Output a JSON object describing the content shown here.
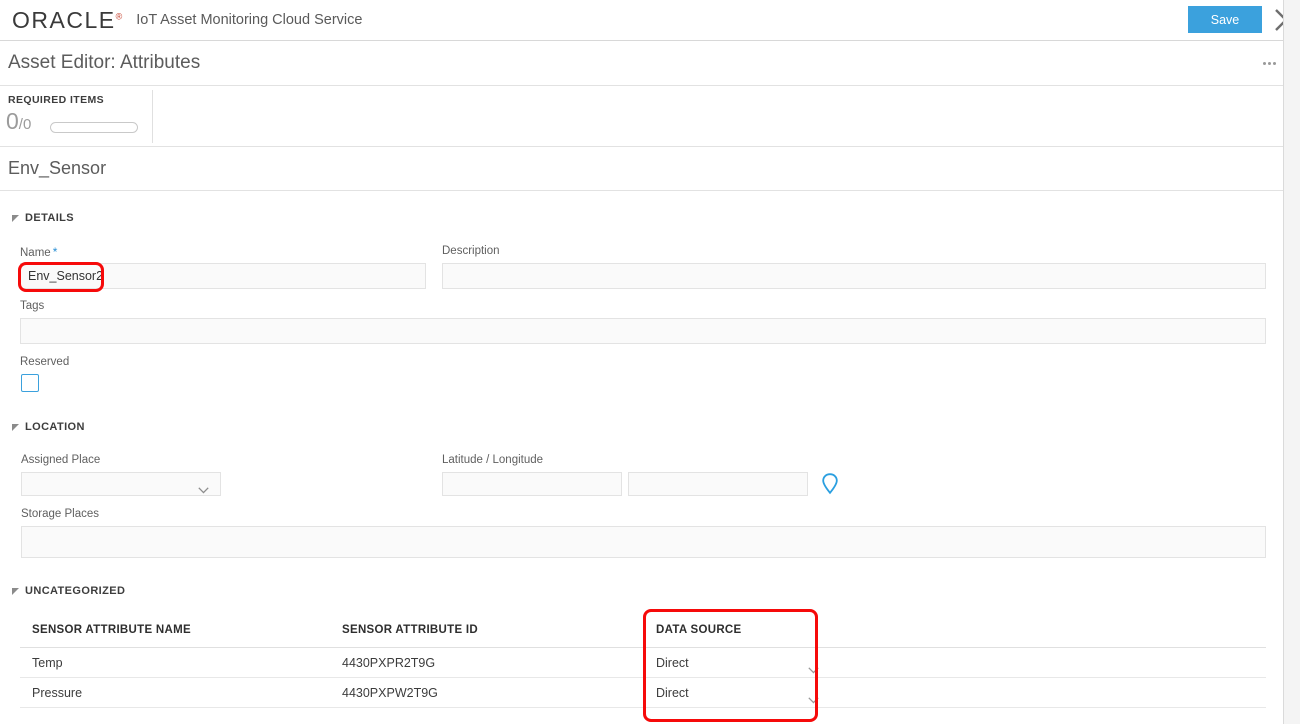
{
  "topbar": {
    "brand": "ORACLE",
    "brand_mark": "®",
    "app_name": "IoT Asset Monitoring Cloud Service",
    "save_label": "Save",
    "close_icon": "close-icon"
  },
  "editor": {
    "title": "Asset Editor: Attributes",
    "overflow_icon": "overflow-menu-icon"
  },
  "required_items": {
    "label": "REQUIRED ITEMS",
    "completed": "0",
    "separator": "/",
    "total": "0",
    "progress_percent": 0
  },
  "asset": {
    "name_banner": "Env_Sensor"
  },
  "sections": {
    "details": {
      "title": "DETAILS",
      "fields": {
        "name_label": "Name",
        "name_required_mark": "*",
        "name_value": "Env_Sensor2",
        "description_label": "Description",
        "description_value": "",
        "tags_label": "Tags",
        "tags_value": "",
        "reserved_label": "Reserved",
        "reserved_checked": false
      }
    },
    "location": {
      "title": "LOCATION",
      "fields": {
        "assigned_place_label": "Assigned Place",
        "assigned_place_value": "",
        "latlong_label": "Latitude / Longitude",
        "latitude_value": "",
        "longitude_value": "",
        "pin_icon": "map-pin-icon",
        "storage_places_label": "Storage Places",
        "storage_places_value": ""
      }
    },
    "uncategorized": {
      "title": "UNCATEGORIZED",
      "table": {
        "columns": [
          "SENSOR ATTRIBUTE NAME",
          "SENSOR ATTRIBUTE ID",
          "DATA SOURCE"
        ],
        "rows": [
          {
            "name": "Temp",
            "id": "4430PXPR2T9G",
            "data_source": "Direct"
          },
          {
            "name": "Pressure",
            "id": "4430PXPW2T9G",
            "data_source": "Direct"
          }
        ]
      }
    }
  },
  "colors": {
    "accent_blue": "#3ba1dd",
    "annotation_red": "#f60a0a",
    "text_gray": "#5c5c5c",
    "field_bg": "#fafafa"
  },
  "annotations": [
    {
      "target": "name-field",
      "shape": "rounded-rect"
    },
    {
      "target": "data-source-column",
      "shape": "rounded-rect"
    }
  ]
}
